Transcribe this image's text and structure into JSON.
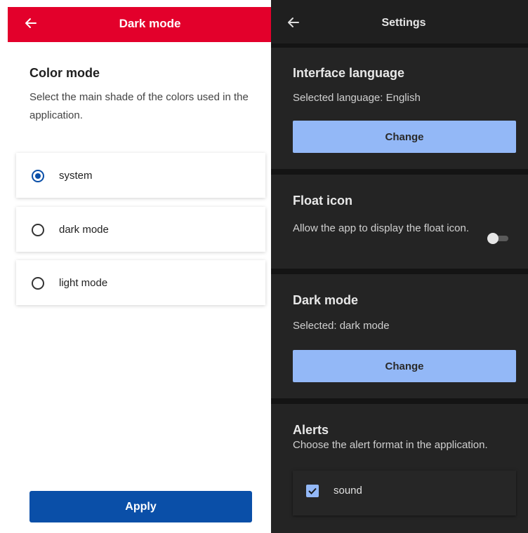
{
  "left": {
    "header_title": "Dark mode",
    "section_title": "Color mode",
    "section_desc": "Select the main shade of the colors used in the application.",
    "options": [
      {
        "label": "system",
        "selected": true
      },
      {
        "label": "dark mode",
        "selected": false
      },
      {
        "label": "light mode",
        "selected": false
      }
    ],
    "apply_label": "Apply",
    "colors": {
      "header": "#e3002b",
      "accent": "#0a4fa8"
    }
  },
  "right": {
    "header_title": "Settings",
    "language": {
      "title": "Interface language",
      "selected_prefix": "Selected language:",
      "selected_value": "English",
      "button": "Change"
    },
    "float_icon": {
      "title": "Float icon",
      "desc": "Allow the app to display the float icon.",
      "enabled": false
    },
    "dark_mode": {
      "title": "Dark mode",
      "selected_prefix": "Selected:",
      "selected_value": "dark mode",
      "button": "Change"
    },
    "alerts": {
      "title": "Alerts",
      "desc": "Choose the alert format in the application.",
      "options": [
        {
          "label": "sound",
          "checked": true
        }
      ]
    },
    "colors": {
      "button": "#93b8f7",
      "background": "#141414",
      "card": "#242424"
    }
  }
}
